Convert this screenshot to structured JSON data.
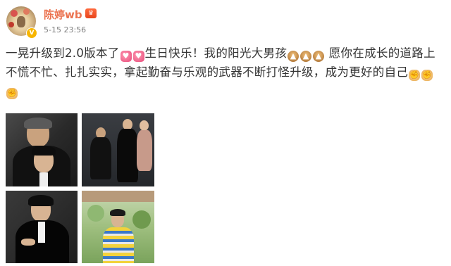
{
  "post": {
    "username": "陈婷wb",
    "timestamp": "5-15 23:56",
    "text_1": "一晃升级到2.0版本了",
    "text_2": "生日快乐！我的阳光大男孩",
    "text_3": "愿你在成长的道路上不慌不忙、扎扎实实，拿起勤奋与乐观的武器不断打怪升级，成为更好的自己"
  },
  "icons": {
    "verified": "verified-badge-icon",
    "vip": "vip-crown-icon",
    "emoji_heart": "heart-emoji-icon",
    "emoji_cake": "cake-emoji-icon",
    "emoji_muscle": "muscle-emoji-icon"
  },
  "colors": {
    "username": "#eb7350",
    "timestamp": "#808080",
    "text": "#333333",
    "verified": "#f7b500"
  }
}
